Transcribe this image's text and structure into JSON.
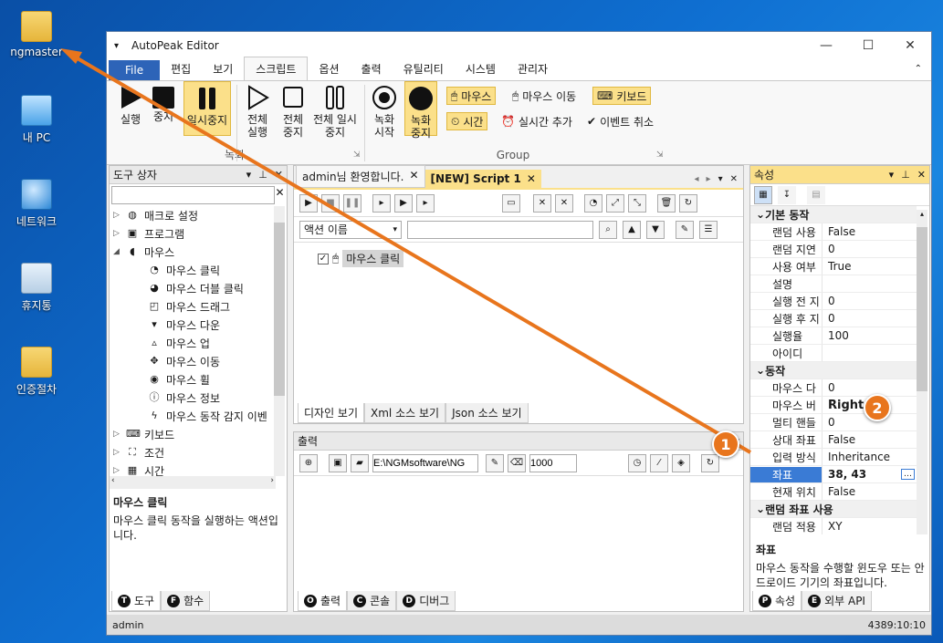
{
  "desktop": {
    "icons": [
      {
        "label": "ngmaster"
      },
      {
        "label": "내 PC"
      },
      {
        "label": "네트워크"
      },
      {
        "label": "휴지통"
      },
      {
        "label": "인증절차"
      }
    ]
  },
  "window": {
    "title": "AutoPeak Editor",
    "menu": [
      "File",
      "편집",
      "보기",
      "스크립트",
      "옵션",
      "출력",
      "유틸리티",
      "시스템",
      "관리자"
    ],
    "ribbon": {
      "run": "실행",
      "stop": "중지",
      "pause": "일시중지",
      "run_all": "전체 실행",
      "stop_all": "전체 중지",
      "pause_all": "전체 일시중지",
      "rec_start": "녹화 시작",
      "rec_stop": "녹화 중지",
      "group_rec": "녹화",
      "mouse": "마우스",
      "mouse_move": "마우스 이동",
      "keyboard": "키보드",
      "time": "시간",
      "realtime_add": "실시간 추가",
      "event_cancel": "이벤트 취소",
      "group": "Group"
    },
    "toolbox": {
      "title": "도구 상자",
      "search_value": "",
      "items": [
        {
          "label": "매크로 설정",
          "level": 0,
          "icon": "globe-icon",
          "arrow": "▷"
        },
        {
          "label": "프로그램",
          "level": 0,
          "icon": "window-icon",
          "arrow": "▷"
        },
        {
          "label": "마우스",
          "level": 0,
          "icon": "mouse-icon",
          "arrow": "◢"
        },
        {
          "label": "마우스 클릭",
          "level": 1,
          "icon": "mouse-click-icon"
        },
        {
          "label": "마우스 더블 클릭",
          "level": 1,
          "icon": "mouse-double-icon"
        },
        {
          "label": "마우스 드래그",
          "level": 1,
          "icon": "mouse-drag-icon"
        },
        {
          "label": "마우스 다운",
          "level": 1,
          "icon": "mouse-down-icon"
        },
        {
          "label": "마우스 업",
          "level": 1,
          "icon": "mouse-up-icon"
        },
        {
          "label": "마우스 이동",
          "level": 1,
          "icon": "move-icon"
        },
        {
          "label": "마우스 휠",
          "level": 1,
          "icon": "mouse-wheel-icon"
        },
        {
          "label": "마우스 정보",
          "level": 1,
          "icon": "info-icon"
        },
        {
          "label": "마우스 동작 감지 이벤",
          "level": 1,
          "icon": "lightning-icon"
        },
        {
          "label": "키보드",
          "level": 0,
          "icon": "keyboard-icon",
          "arrow": "▷"
        },
        {
          "label": "조건",
          "level": 0,
          "icon": "condition-icon",
          "arrow": "▷"
        },
        {
          "label": "시간",
          "level": 0,
          "icon": "calendar-icon",
          "arrow": "▷"
        }
      ],
      "desc_title": "마우스 클릭",
      "desc_text": "마우스 클릭 동작을 실행하는 액션입니다.",
      "tabs": [
        "도구",
        "함수"
      ]
    },
    "editor": {
      "tabs": [
        "admin님 환영합니다.",
        "[NEW] Script 1"
      ],
      "action_select": "액션 이름",
      "search_value": "",
      "node_label": "마우스 클릭",
      "bottom_tabs": [
        "디자인 보기",
        "Xml 소스 보기",
        "Json 소스 보기"
      ]
    },
    "output": {
      "title": "출력",
      "path": "E:\\NGMsoftware\\NG",
      "count": "1000",
      "tabs": [
        "출력",
        "콘솔",
        "디버그"
      ]
    },
    "properties": {
      "title": "속성",
      "rows": [
        {
          "cat": "기본 동작"
        },
        {
          "k": "랜덤 사용",
          "v": "False"
        },
        {
          "k": "랜덤 지연",
          "v": "0"
        },
        {
          "k": "사용 여부",
          "v": "True"
        },
        {
          "k": "설명",
          "v": ""
        },
        {
          "k": "실행 전 지",
          "v": "0"
        },
        {
          "k": "실행 후 지",
          "v": "0"
        },
        {
          "k": "실행율",
          "v": "100"
        },
        {
          "k": "아이디",
          "v": ""
        },
        {
          "cat": "동작"
        },
        {
          "k": "마우스 다",
          "v": "0"
        },
        {
          "k": "마우스 버",
          "v": "Right"
        },
        {
          "k": "멀티 핸들",
          "v": "0"
        },
        {
          "k": "상대 좌표",
          "v": "False"
        },
        {
          "k": "입력 방식",
          "v": "Inheritance"
        },
        {
          "k": "좌표",
          "v": "38, 43",
          "sel": true
        },
        {
          "k": "현재 위치",
          "v": "False"
        },
        {
          "cat": "랜덤 좌표 사용"
        },
        {
          "k": "랜덤 적용",
          "v": "XY"
        }
      ],
      "desc_title": "좌표",
      "desc_text": "마우스 동작을 수행할 윈도우 또는 안드로이드 기기의 좌표입니다.",
      "tabs": [
        "속성",
        "외부 API"
      ]
    },
    "status": {
      "user": "admin",
      "time": "4389:10:10"
    }
  },
  "annotations": {
    "badge1": "1",
    "badge2": "2"
  },
  "colors": {
    "accent": "#2d64b8",
    "highlight": "#fbe08a",
    "arrow": "#e8751d",
    "selection": "#3a7bd5"
  }
}
